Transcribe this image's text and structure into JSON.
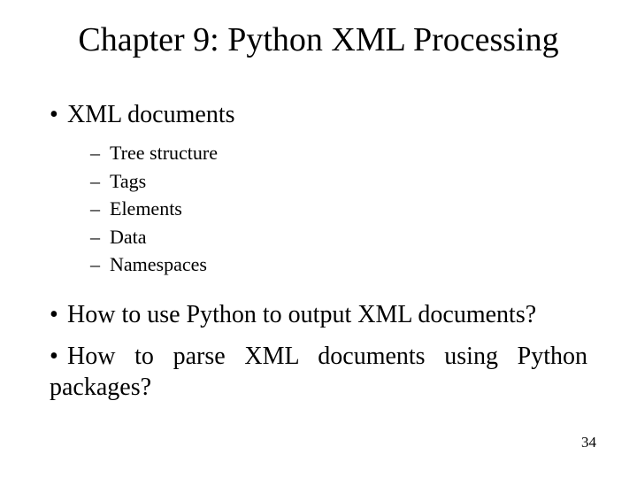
{
  "title": "Chapter 9: Python XML Processing",
  "bullets": {
    "b1": "XML documents",
    "sub": {
      "s1": "Tree structure",
      "s2": "Tags",
      "s3": "Elements",
      "s4": "Data",
      "s5": "Namespaces"
    },
    "b2": "How to use Python to output XML documents?",
    "b3": "How to parse XML documents using Python packages?"
  },
  "page_number": "34"
}
